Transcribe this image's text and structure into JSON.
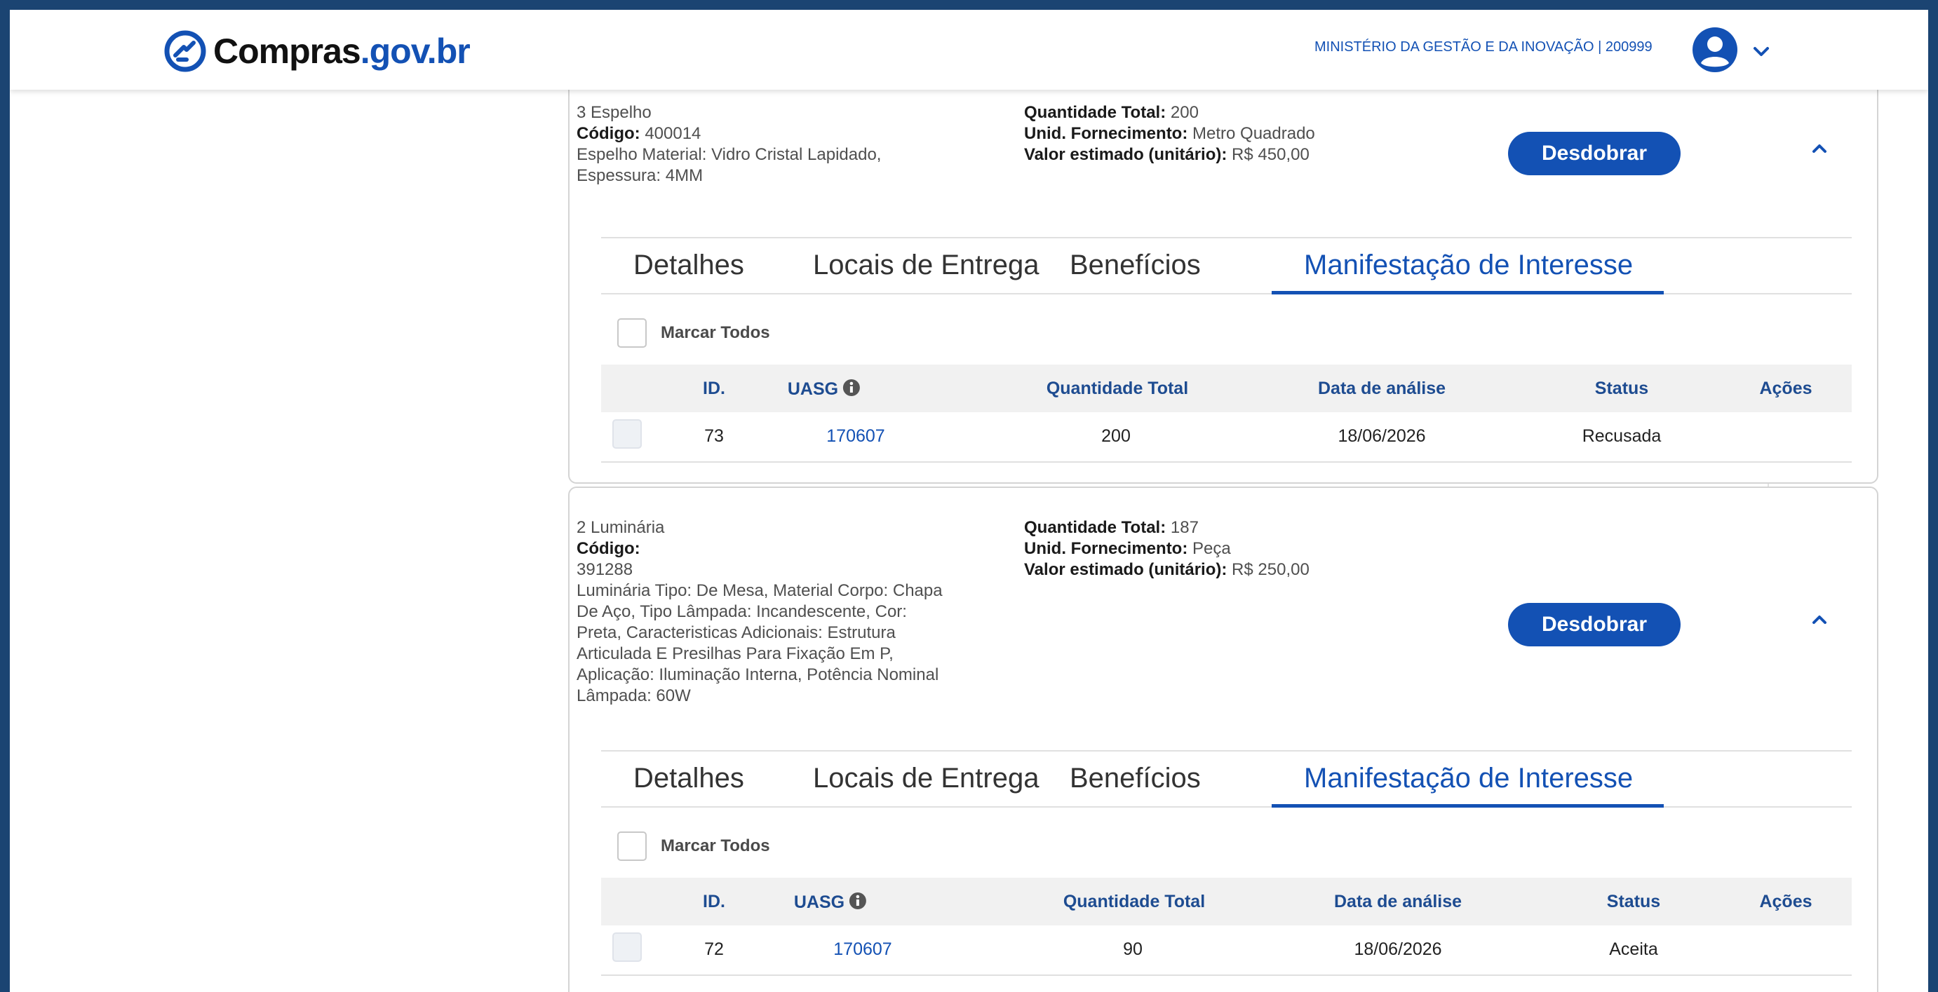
{
  "header": {
    "logo_text": "Compras",
    "logo_suffix": ".gov.br",
    "org_label": "MINISTÉRIO DA GESTÃO E DA INOVAÇÃO | 200999",
    "avatar_icon": "user-avatar-icon",
    "menu_icon": "chevron-down-icon"
  },
  "colors": {
    "brand": "#1351b4",
    "frame": "#1b4472"
  },
  "items": [
    {
      "title": "3 Espelho",
      "codigo_label": "Código:",
      "codigo": "400014",
      "descricao": [
        "Espelho Material: Vidro Cristal Lapidado,",
        "Espessura: 4MM"
      ],
      "qtd_label": "Quantidade Total:",
      "qtd": "200",
      "unid_label": "Unid. Fornecimento:",
      "unid": "Metro Quadrado",
      "valor_label": "Valor estimado (unitário):",
      "valor": "R$ 450,00",
      "button": "Desdobrar",
      "tabs": [
        "Detalhes",
        "Locais de Entrega",
        "Benefícios",
        "Manifestação de Interesse"
      ],
      "active_tab": "Manifestação de Interesse",
      "marcar_todos": "Marcar Todos",
      "columns": [
        "ID.",
        "UASG",
        "Quantidade Total",
        "Data de análise",
        "Status",
        "Ações"
      ],
      "rows": [
        {
          "id": "73",
          "uasg": "170607",
          "quantidade": "200",
          "data": "18/06/2026",
          "status": "Recusada",
          "acoes": ""
        }
      ]
    },
    {
      "title": "2 Luminária",
      "codigo_label": "Código:",
      "codigo": "391288",
      "descricao": [
        "Luminária Tipo: De Mesa, Material Corpo: Chapa",
        "De Aço, Tipo Lâmpada: Incandescente, Cor:",
        "Preta, Caracteristicas Adicionais: Estrutura",
        "Articulada E Presilhas Para Fixação Em P,",
        "Aplicação: Iluminação Interna, Potência Nominal",
        "Lâmpada: 60W"
      ],
      "qtd_label": "Quantidade Total:",
      "qtd": "187",
      "unid_label": "Unid. Fornecimento:",
      "unid": "Peça",
      "valor_label": "Valor estimado (unitário):",
      "valor": "R$ 250,00",
      "button": "Desdobrar",
      "tabs": [
        "Detalhes",
        "Locais de Entrega",
        "Benefícios",
        "Manifestação de Interesse"
      ],
      "active_tab": "Manifestação de Interesse",
      "marcar_todos": "Marcar Todos",
      "columns": [
        "ID.",
        "UASG",
        "Quantidade Total",
        "Data de análise",
        "Status",
        "Ações"
      ],
      "rows": [
        {
          "id": "72",
          "uasg": "170607",
          "quantidade": "90",
          "data": "18/06/2026",
          "status": "Aceita",
          "acoes": ""
        }
      ]
    }
  ]
}
